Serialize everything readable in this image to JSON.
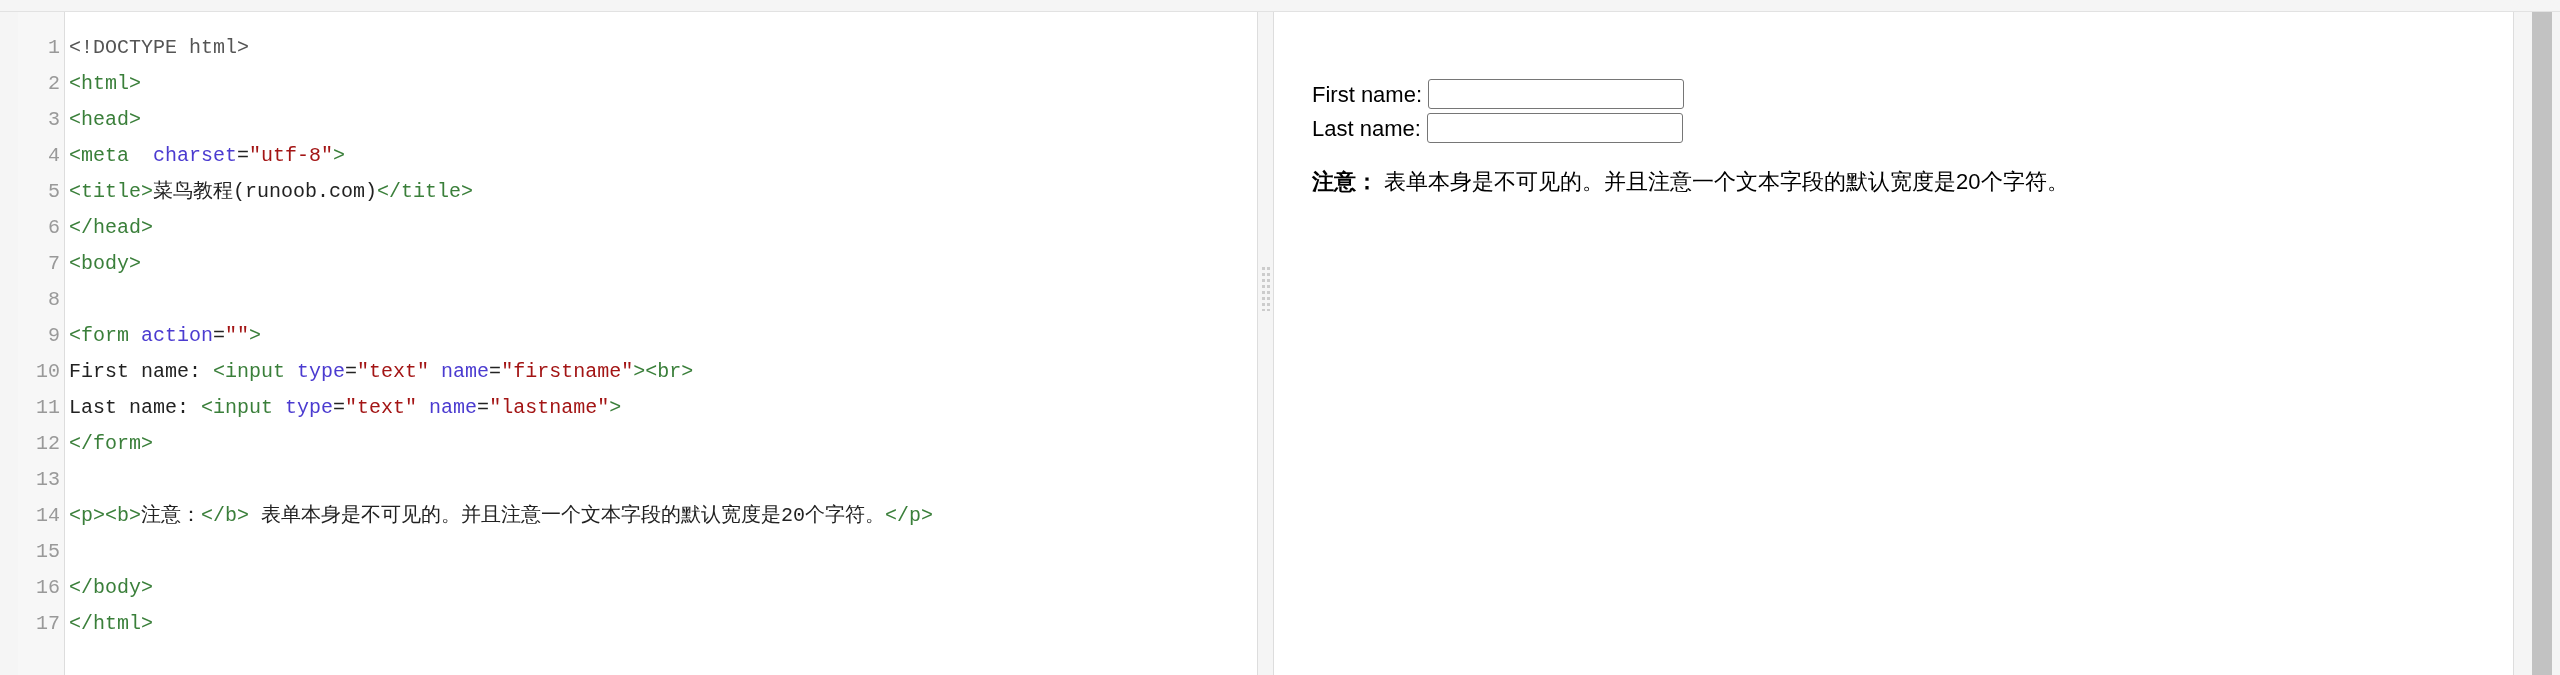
{
  "editor": {
    "lines": [
      {
        "number": "1",
        "tokens": [
          {
            "kind": "doctype",
            "text": "<!DOCTYPE html>"
          }
        ]
      },
      {
        "number": "2",
        "tokens": [
          {
            "kind": "tag",
            "text": "<html>"
          }
        ]
      },
      {
        "number": "3",
        "tokens": [
          {
            "kind": "tag",
            "text": "<head>"
          }
        ]
      },
      {
        "number": "4",
        "tokens": [
          {
            "kind": "tag",
            "text": "<meta  "
          },
          {
            "kind": "attr",
            "text": "charset"
          },
          {
            "kind": "text",
            "text": "="
          },
          {
            "kind": "string",
            "text": "\"utf-8\""
          },
          {
            "kind": "tag",
            "text": ">"
          }
        ]
      },
      {
        "number": "5",
        "tokens": [
          {
            "kind": "tag",
            "text": "<title>"
          },
          {
            "kind": "text",
            "text": "菜鸟教程(runoob.com)"
          },
          {
            "kind": "tag",
            "text": "</title>"
          }
        ]
      },
      {
        "number": "6",
        "tokens": [
          {
            "kind": "tag",
            "text": "</head>"
          }
        ]
      },
      {
        "number": "7",
        "tokens": [
          {
            "kind": "tag",
            "text": "<body>"
          }
        ]
      },
      {
        "number": "8"
      },
      {
        "number": "9",
        "tokens": [
          {
            "kind": "tag",
            "text": "<form "
          },
          {
            "kind": "attr",
            "text": "action"
          },
          {
            "kind": "text",
            "text": "="
          },
          {
            "kind": "string",
            "text": "\"\""
          },
          {
            "kind": "tag",
            "text": ">"
          }
        ]
      },
      {
        "number": "10",
        "tokens": [
          {
            "kind": "text",
            "text": "First name: "
          },
          {
            "kind": "tag",
            "text": "<input "
          },
          {
            "kind": "attr",
            "text": "type"
          },
          {
            "kind": "text",
            "text": "="
          },
          {
            "kind": "string",
            "text": "\"text\" "
          },
          {
            "kind": "attr",
            "text": "name"
          },
          {
            "kind": "text",
            "text": "="
          },
          {
            "kind": "string",
            "text": "\"firstname\""
          },
          {
            "kind": "tag",
            "text": "><br>"
          }
        ]
      },
      {
        "number": "11",
        "tokens": [
          {
            "kind": "text",
            "text": "Last name: "
          },
          {
            "kind": "tag",
            "text": "<input "
          },
          {
            "kind": "attr",
            "text": "type"
          },
          {
            "kind": "text",
            "text": "="
          },
          {
            "kind": "string",
            "text": "\"text\" "
          },
          {
            "kind": "attr",
            "text": "name"
          },
          {
            "kind": "text",
            "text": "="
          },
          {
            "kind": "string",
            "text": "\"lastname\""
          },
          {
            "kind": "tag",
            "text": ">"
          }
        ]
      },
      {
        "number": "12",
        "tokens": [
          {
            "kind": "tag",
            "text": "</form>"
          }
        ]
      },
      {
        "number": "13"
      },
      {
        "number": "14",
        "tokens": [
          {
            "kind": "tag",
            "text": "<p><b>"
          },
          {
            "kind": "text",
            "text": "注意："
          },
          {
            "kind": "tag",
            "text": "</b>"
          },
          {
            "kind": "text",
            "text": " 表单本身是不可见的。并且注意一个文本字段的默认宽度是20个字符。"
          },
          {
            "kind": "tag",
            "text": "</p>"
          }
        ]
      },
      {
        "number": "15"
      },
      {
        "number": "16",
        "tokens": [
          {
            "kind": "tag",
            "text": "</body>"
          }
        ]
      },
      {
        "number": "17",
        "tokens": [
          {
            "kind": "tag",
            "text": "</html>"
          }
        ]
      }
    ]
  },
  "preview": {
    "fields": [
      {
        "label": "First name:"
      },
      {
        "label": "Last name:"
      }
    ],
    "note": "**注意：** 表单本身是不可见的。并且注意一个文本字段的默认宽度是20个字符。"
  }
}
